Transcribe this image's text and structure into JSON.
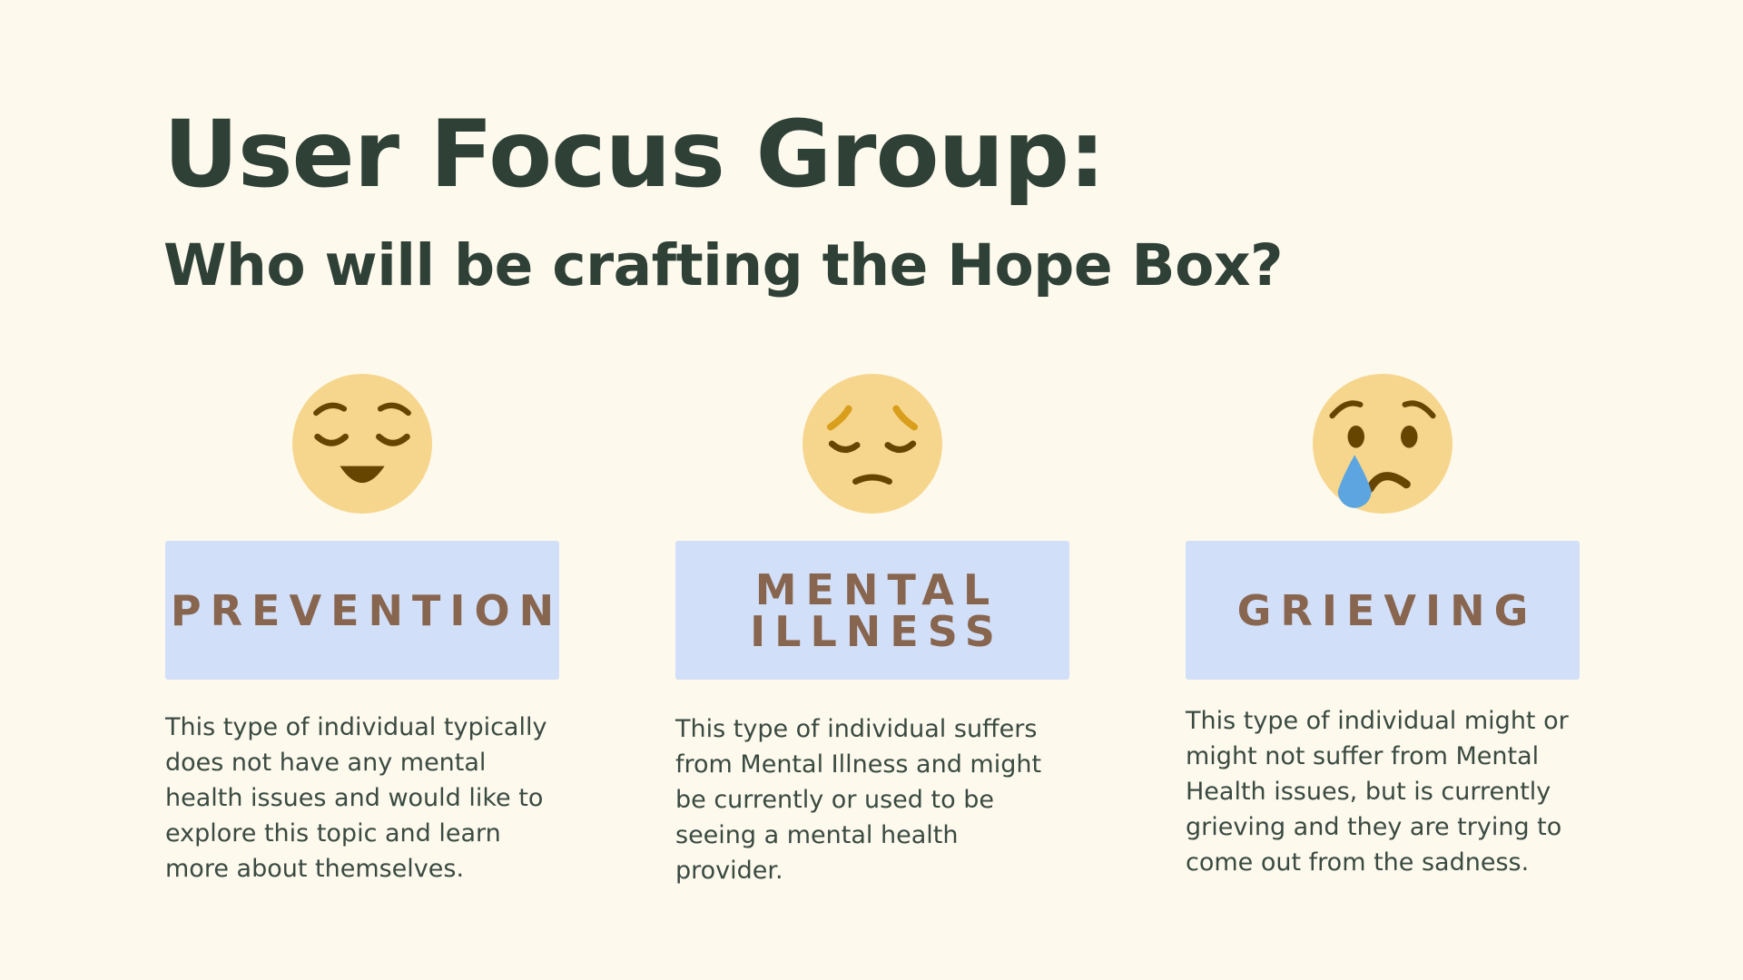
{
  "title": "User Focus Group:",
  "subtitle": "Who will be crafting the Hope Box?",
  "groups": [
    {
      "icon": "relieved-face-icon",
      "label": "PREVENTION",
      "description": "This type of individual typically does not have any mental health issues and would like to explore this topic and learn more about themselves."
    },
    {
      "icon": "pensive-face-icon",
      "label": "MENTAL ILLNESS",
      "description": "This type of individual suffers from Mental Illness and might be currently or used to be seeing a mental health provider."
    },
    {
      "icon": "crying-face-icon",
      "label": "GRIEVING",
      "description": "This type of individual might or might not suffer from Mental Health issues, but is currently grieving and they are trying to come out from the sadness."
    }
  ],
  "colors": {
    "background": "#fdf9ed",
    "heading": "#2f4037",
    "label_box": "#d2dff8",
    "label_text": "#87654f",
    "emoji_face": "#f6d68d",
    "tear": "#5da5e0"
  }
}
